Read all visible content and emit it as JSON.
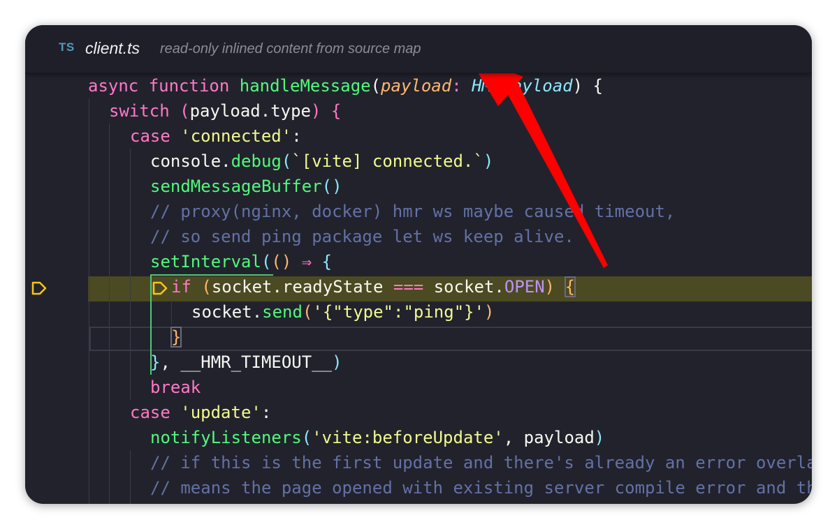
{
  "tab": {
    "lang_badge": "TS",
    "filename": "client.ts",
    "description": "read-only inlined content from source map"
  },
  "icons": {
    "language": "typescript-icon",
    "breakpoint": "breakpoint-current-icon",
    "annotation": "red-arrow-annotation"
  },
  "colors": {
    "editor_bg": "#22222d",
    "current_line_bg": "#4b4a22",
    "breakpoint": "#f5c518",
    "annotation_arrow": "#ff0000",
    "active_guide": "#50c878"
  },
  "code": {
    "l1": {
      "kw": "async function ",
      "fn": "handleMessage",
      "p1": "(",
      "param": "payload",
      "colon": ": ",
      "type": "HMRPayload",
      "p2": ")",
      "rest": " {"
    },
    "l2": {
      "kw": "switch",
      "s": " ",
      "p1": "(",
      "expr": "payload.type",
      "p2": ")",
      "rest": " {"
    },
    "l3": {
      "kw": "case",
      "s": " ",
      "str": "'connected'",
      "rest": ":"
    },
    "l4": {
      "obj": "console.",
      "fn": "debug",
      "p1": "(",
      "str": "`[vite] connected.`",
      "p2": ")"
    },
    "l5": {
      "fn": "sendMessageBuffer",
      "p1": "()"
    },
    "l6": {
      "cm": "// proxy(nginx, docker) hmr ws maybe caused timeout,"
    },
    "l7": {
      "cm": "// so send ping package let ws keep alive."
    },
    "l8": {
      "fn": "setInterval",
      "p1": "(",
      "p2": "()",
      "s": " ",
      "arrow": "⇒",
      "rest": " {"
    },
    "l9": {
      "kw": "if",
      "s": " ",
      "p1": "(",
      "obj": "socket.readyState",
      "s2": " ",
      "op": "===",
      "s3": " ",
      "obj2": "socket.",
      "const": "OPEN",
      "p2": ")",
      "s4": " ",
      "brace": "{"
    },
    "l10": {
      "obj": "socket.",
      "fn": "send",
      "p1": "(",
      "str": "'{\"type\":\"ping\"}'",
      "p2": ")"
    },
    "l11": {
      "brace": "}"
    },
    "l12": {
      "brace": "}",
      "rest": ", __HMR_TIMEOUT__",
      "p1": ")"
    },
    "l13": {
      "kw": "break"
    },
    "l14": {
      "kw": "case",
      "s": " ",
      "str": "'update'",
      "rest": ":"
    },
    "l15": {
      "fn": "notifyListeners",
      "p1": "(",
      "str": "'vite:beforeUpdate'",
      "rest": ", payload",
      "p2": ")"
    },
    "l16": {
      "cm": "// if this is the first update and there's already an error overlay, it"
    },
    "l17": {
      "cm": "// means the page opened with existing server compile error and the whole"
    }
  }
}
